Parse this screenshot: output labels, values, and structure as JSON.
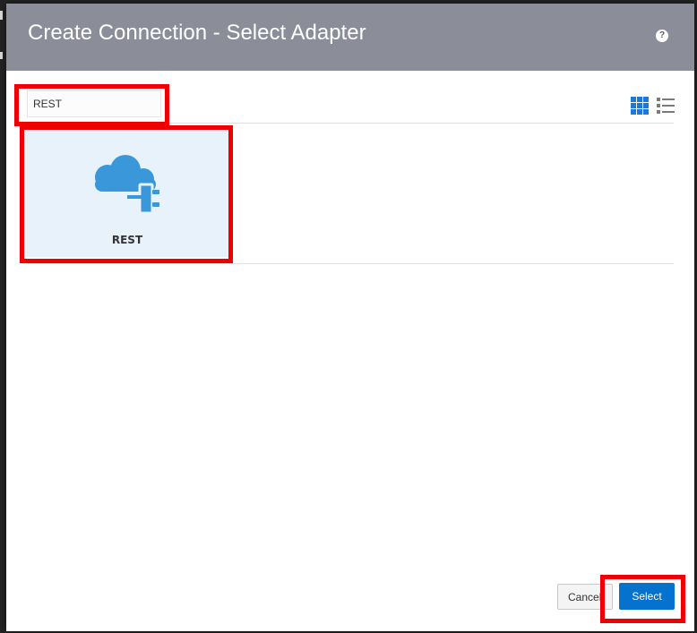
{
  "dialog": {
    "title": "Create Connection - Select Adapter",
    "help_icon": "?"
  },
  "search": {
    "value": "REST"
  },
  "view_toggle": {
    "grid_icon": "grid-view-icon",
    "list_icon": "list-view-icon"
  },
  "adapters": [
    {
      "label": "REST",
      "icon": "cloud-plug-icon"
    }
  ],
  "footer": {
    "cancel_label": "Cancel",
    "select_label": "Select"
  },
  "colors": {
    "header": "#8b8d99",
    "accent": "#0572ce",
    "card": "#e8f2fa",
    "highlight": "#ee0000"
  }
}
